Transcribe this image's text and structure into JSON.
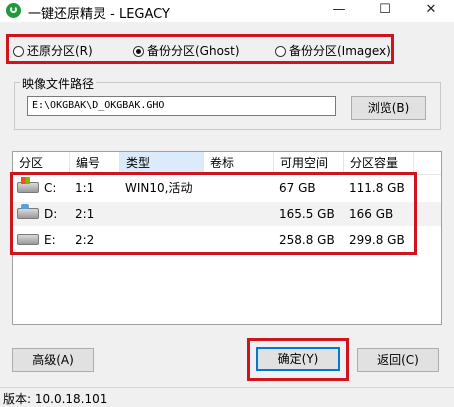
{
  "window": {
    "title": "一键还原精灵 - LEGACY",
    "minimize_glyph": "—",
    "maximize_glyph": "☐",
    "close_glyph": "✕"
  },
  "mode": {
    "options": [
      {
        "label": "还原分区(R)",
        "selected": false
      },
      {
        "label": "备份分区(Ghost)",
        "selected": true
      },
      {
        "label": "备份分区(Imagex)",
        "selected": false
      }
    ]
  },
  "image_path": {
    "label": "映像文件路径",
    "value": "E:\\OKGBAK\\D_OKGBAK.GHO",
    "browse_label": "浏览(B)"
  },
  "partition_table": {
    "columns": [
      "分区",
      "编号",
      "类型",
      "卷标",
      "可用空间",
      "分区容量"
    ],
    "rows": [
      {
        "drive": "C:",
        "number": "1:1",
        "type": "WIN10,活动",
        "label": "",
        "free": "67 GB",
        "capacity": "111.8 GB",
        "icon": "system-drive-icon"
      },
      {
        "drive": "D:",
        "number": "2:1",
        "type": "",
        "label": "",
        "free": "165.5 GB",
        "capacity": "166 GB",
        "icon": "data-drive-icon"
      },
      {
        "drive": "E:",
        "number": "2:2",
        "type": "",
        "label": "",
        "free": "258.8 GB",
        "capacity": "299.8 GB",
        "icon": "drive-icon"
      }
    ]
  },
  "buttons": {
    "advanced": "高级(A)",
    "ok": "确定(Y)",
    "back": "返回(C)"
  },
  "status": {
    "version": "版本: 10.0.18.101"
  },
  "colors": {
    "highlight_box": "#d0141e",
    "focus_border": "#0078d7",
    "app_icon": "#1e9b3b"
  }
}
